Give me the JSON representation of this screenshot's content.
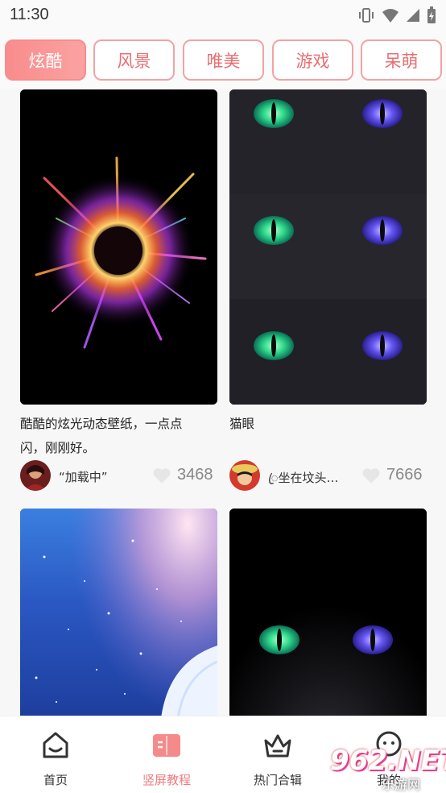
{
  "status_bar": {
    "time": "11:30"
  },
  "tabs": [
    {
      "label": "炫酷",
      "active": true
    },
    {
      "label": "风景",
      "active": false
    },
    {
      "label": "唯美",
      "active": false
    },
    {
      "label": "游戏",
      "active": false
    },
    {
      "label": "呆萌",
      "active": false
    }
  ],
  "cards": [
    {
      "title_line1": "酷酷的炫光动态壁纸，一点点",
      "title_line2": "闪，刚刚好。",
      "author": "“加载中”",
      "likes": "3468"
    },
    {
      "title_line1": "猫眼",
      "title_line2": "",
      "author": "ꦿ坐在坟头…",
      "likes": "7666"
    },
    {
      "title_line1": "",
      "title_line2": "",
      "author": "",
      "likes": ""
    },
    {
      "title_line1": "",
      "title_line2": "",
      "author": "",
      "likes": ""
    }
  ],
  "bottom_nav": [
    {
      "label": "首页",
      "icon": "home-icon",
      "active": false
    },
    {
      "label": "竖屏教程",
      "icon": "book-icon",
      "active": true
    },
    {
      "label": "热门合辑",
      "icon": "crown-icon",
      "active": false
    },
    {
      "label": "我的",
      "icon": "profile-icon",
      "active": false
    }
  ],
  "watermark": {
    "brand": "962.NET",
    "sub": "乐游网"
  },
  "colors": {
    "accent": "#f98c8c",
    "tab_border": "#f2a3a3",
    "tab_text": "#e86f72",
    "nav_active": "#f07b7b"
  }
}
